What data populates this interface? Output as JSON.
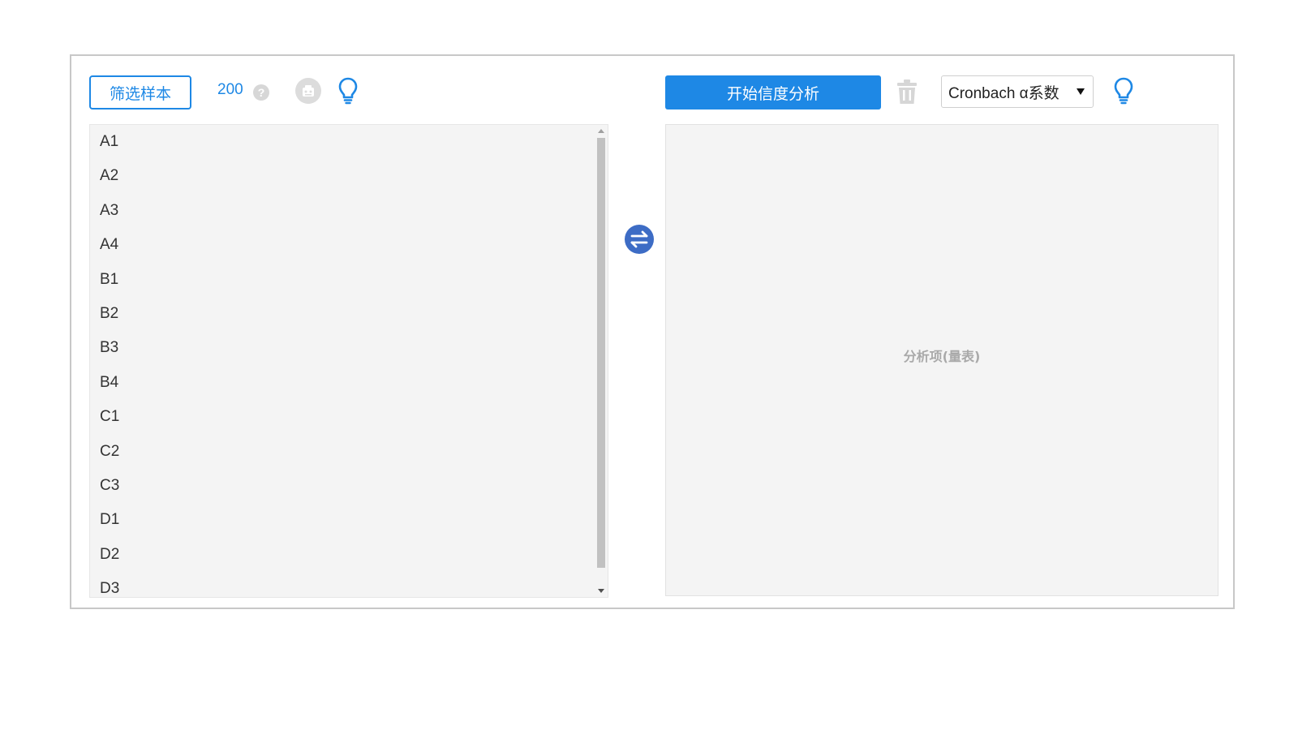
{
  "toolbar_left": {
    "filter_button_label": "筛选样本",
    "sample_count": "200",
    "help_symbol": "?",
    "icons": [
      "robot-icon",
      "lightbulb-icon"
    ]
  },
  "variables": {
    "items": [
      {
        "label": "A1"
      },
      {
        "label": "A2"
      },
      {
        "label": "A3"
      },
      {
        "label": "A4"
      },
      {
        "label": "B1"
      },
      {
        "label": "B2"
      },
      {
        "label": "B3"
      },
      {
        "label": "B4"
      },
      {
        "label": "C1"
      },
      {
        "label": "C2"
      },
      {
        "label": "C3"
      },
      {
        "label": "D1"
      },
      {
        "label": "D2"
      },
      {
        "label": "D3"
      }
    ]
  },
  "transfer": {
    "icon": "swap-arrows-icon"
  },
  "toolbar_right": {
    "start_button_label": "开始信度分析",
    "method_selected": "Cronbach α系数",
    "icons": [
      "trash-icon",
      "lightbulb-icon"
    ]
  },
  "analysis_area": {
    "placeholder": "分析项(量表)"
  },
  "colors": {
    "accent": "#1e88e5",
    "swap": "#3d6cc5",
    "panel_bg": "#f4f4f4",
    "border": "#c8c8c8"
  }
}
